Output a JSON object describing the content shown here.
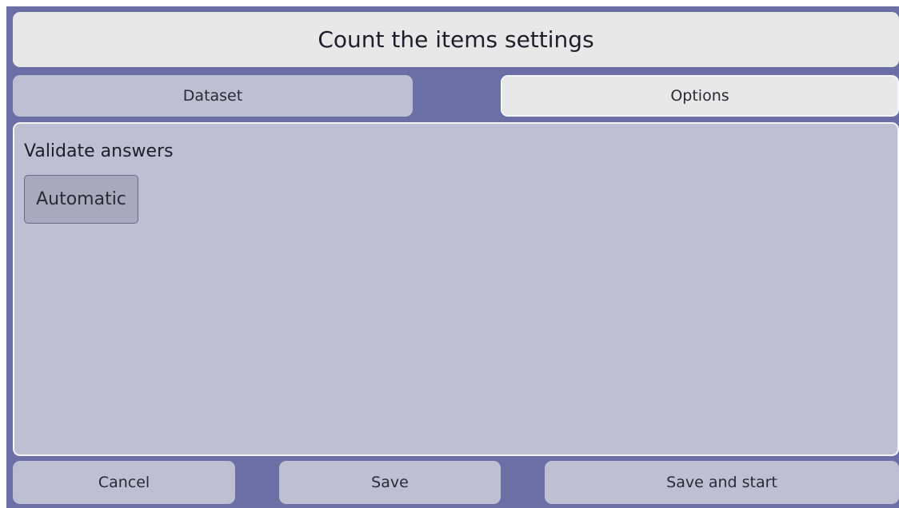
{
  "header": {
    "title": "Count the items settings"
  },
  "tabs": [
    {
      "label": "Dataset",
      "active": false
    },
    {
      "label": "Options",
      "active": true
    }
  ],
  "options": {
    "validate_label": "Validate answers",
    "validate_mode": "Automatic"
  },
  "footer": {
    "cancel_label": "Cancel",
    "save_label": "Save",
    "save_start_label": "Save and start"
  },
  "colors": {
    "background": "#6b6fa6",
    "panel": "#bebfd3",
    "active_tab": "#e8e8e8",
    "toggle": "#a8a9bc"
  }
}
